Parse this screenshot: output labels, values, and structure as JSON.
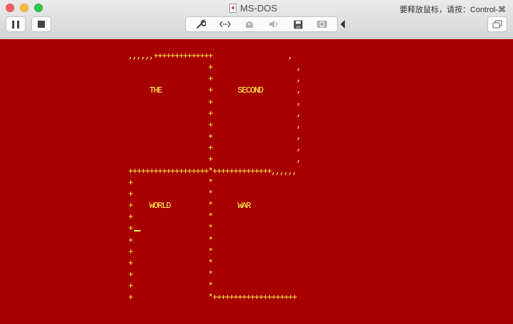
{
  "window": {
    "title": "MS-DOS",
    "release_hint": "要释放鼠标，请按：Control-⌘"
  },
  "toolbar": {
    "icons": [
      "pause-icon",
      "stop-icon",
      "wrench-icon",
      "network-icon",
      "drive-icon",
      "sound-icon",
      "floppy-icon",
      "sync-icon",
      "collapse-arrow-icon",
      "copy-window-icon"
    ]
  },
  "dos_screen": {
    "text": ",,,,,,++++++++++++++                  ,\n                   +                    ,\n                   +                    ,\n     THE           +      SECOND        ,\n                   +                    ,\n                   +                    ,\n                   +                    ,\n                   +                    ,\n                   +                    ,\n                   +                    ,\n+++++++++++++++++++*++++++++++++++,,,,,,\n+                  *\n+                  *\n+    WORLD         *      WAR\n+                  *\n+                  *\n+                  *\n+                  *\n+                  *\n+                  *\n+                  *\n+                  *++++++++++++++++++++",
    "colors": {
      "background": "#a80000",
      "foreground": "#ffff55"
    }
  }
}
